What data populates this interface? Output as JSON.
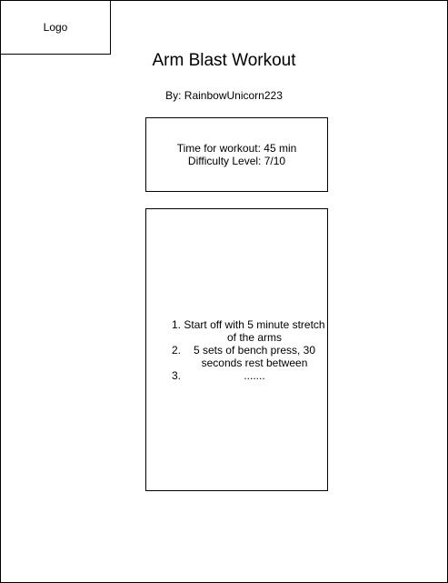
{
  "logo": {
    "label": "Logo"
  },
  "header": {
    "title": "Arm Blast Workout",
    "author": "By: RainbowUnicorn223"
  },
  "info": {
    "time": "Time for workout: 45 min",
    "difficulty": "Difficulty Level: 7/10"
  },
  "steps": [
    {
      "number": "1.",
      "text": "Start off with 5 minute stretch of the arms"
    },
    {
      "number": "2.",
      "text": "5 sets of bench press, 30 seconds rest between"
    },
    {
      "number": "3.",
      "text": "......."
    }
  ]
}
